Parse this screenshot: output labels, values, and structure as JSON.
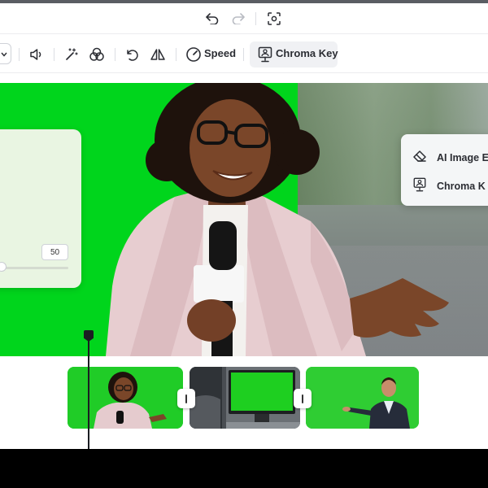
{
  "toolbar": {
    "speed_label": "Speed",
    "chroma_key_label": "Chroma Key",
    "icons": [
      "chevron-down-icon",
      "volume-icon",
      "magic-wand-icon",
      "color-filter-icon",
      "rotate-icon",
      "flip-icon",
      "speed-icon",
      "chroma-key-icon"
    ]
  },
  "header": {
    "icons": [
      "undo-icon",
      "redo-icon",
      "screenshot-icon"
    ]
  },
  "preview": {
    "adjust_value": "50",
    "slider_level": 0,
    "menu": [
      {
        "label": "AI Image E",
        "icon": "eraser-icon"
      },
      {
        "label": "Chroma K",
        "icon": "chroma-key-icon"
      }
    ]
  },
  "timeline": {
    "clips": [
      "clip-woman-green-screen",
      "clip-green-monitor",
      "clip-man-green-screen"
    ]
  },
  "colors": {
    "green_screen": "#00d51c",
    "accent": "#2b2d33"
  }
}
